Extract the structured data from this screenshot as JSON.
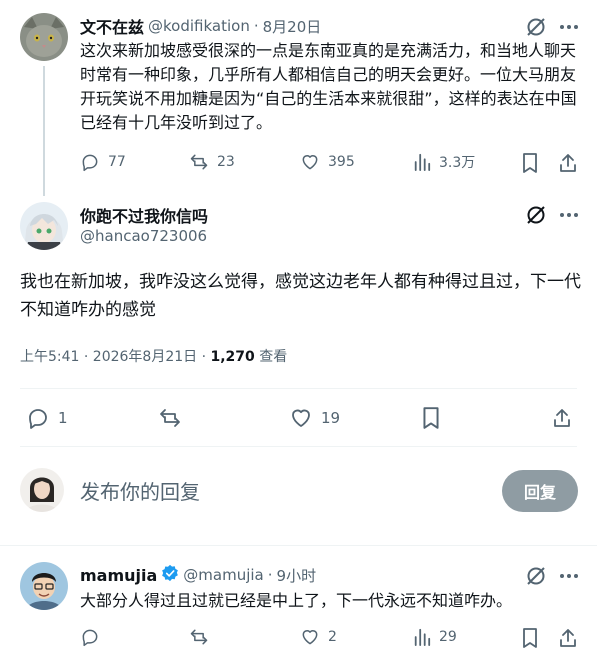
{
  "tweet1": {
    "name": "文不在兹",
    "handle": "@kodifikation",
    "dot": "·",
    "date": "8月20日",
    "text": "这次来新加坡感受很深的一点是东南亚真的是充满活力，和当地人聊天时常有一种印象，几乎所有人都相信自己的明天会更好。一位大马朋友开玩笑说不用加糖是因为“自己的生活本来就很甜”，这样的表达在中国已经有十几年没听到过了。",
    "replies": "77",
    "reposts": "23",
    "likes": "395",
    "views": "3.3万"
  },
  "tweet2": {
    "name": "你跑不过我你信吗",
    "handle": "@hancao723006",
    "text": "我也在新加坡，我咋没这么觉得，感觉这边老年人都有种得过且过，下一代不知道咋办的感觉",
    "time": "上午5:41 · 2026年8月21日 · ",
    "views_count": "1,270",
    "views_label": " 查看",
    "replies": "1",
    "likes": "19"
  },
  "reply_box": {
    "placeholder": "发布你的回复",
    "button": "回复"
  },
  "tweet3": {
    "name": "mamujia",
    "handle": "@mamujia",
    "dot": "·",
    "time": "9小时",
    "text": "大部分人得过且过就已经是中上了，下一代永远不知道咋办。",
    "likes": "2",
    "views": "29"
  },
  "colors": {
    "text": "#0f1419",
    "secondary": "#536471",
    "verified": "#1d9bf0",
    "border": "#eff3f4",
    "button_disabled": "#8f9ca3"
  }
}
